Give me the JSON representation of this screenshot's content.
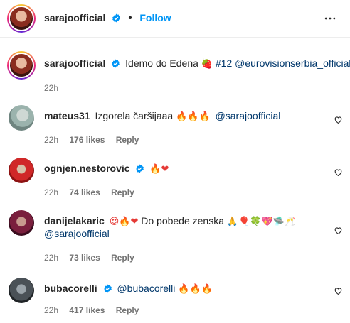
{
  "header": {
    "username": "sarajoofficial",
    "dot": "•",
    "follow_label": "Follow"
  },
  "caption": {
    "username": "sarajoofficial",
    "text_before": "Idemo do Edena",
    "emoji": "🍓",
    "hashtag": "#12",
    "mention": "@eurovisionserbia_official",
    "time": "22h"
  },
  "comments": [
    {
      "username": "mateus31",
      "verified": false,
      "text": "Izgorela čaršijaaa",
      "emoji": "🔥🔥🔥",
      "mention": "@sarajoofficial",
      "time": "22h",
      "likes": "176 likes",
      "reply": "Reply"
    },
    {
      "username": "ognjen.nestorovic",
      "verified": true,
      "text": "",
      "emoji": "🔥❤",
      "time": "22h",
      "likes": "74 likes",
      "reply": "Reply"
    },
    {
      "username": "danijelakaric",
      "verified": false,
      "emoji_lead": "😍🔥❤",
      "text": "Do pobede zenska",
      "emoji_trail": "🙏🎈🍀💖🛸🥂",
      "mention": "@sarajoofficial",
      "time": "22h",
      "likes": "73 likes",
      "reply": "Reply"
    },
    {
      "username": "bubacorelli",
      "verified": true,
      "mention": "@bubacorelli",
      "emoji": "🔥🔥🔥",
      "time": "22h",
      "likes": "417 likes",
      "reply": "Reply"
    }
  ],
  "icons": {
    "verified": "verified-badge-icon",
    "more": "more-options-icon",
    "like": "heart-outline-icon"
  },
  "colors": {
    "accent": "#0095f6",
    "verified": "#0095f6",
    "mention": "#00376b",
    "muted": "#737373"
  }
}
